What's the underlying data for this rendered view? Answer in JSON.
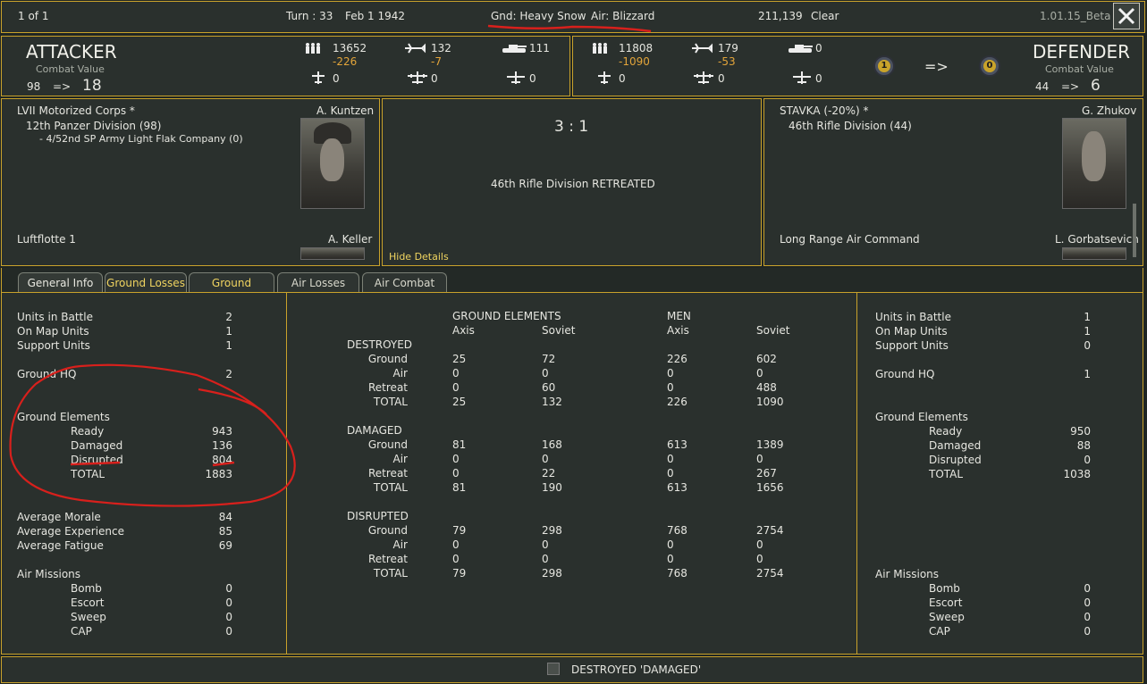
{
  "topbar": {
    "page": "1 of 1",
    "turn": "Turn : 33",
    "date": "Feb 1 1942",
    "ground_weather": "Gnd: Heavy Snow",
    "air_weather": "Air: Blizzard",
    "score": "211,139",
    "weather": "Clear",
    "version": "1.01.15_Beta"
  },
  "attacker": {
    "title": "ATTACKER",
    "combat_value_label": "Combat Value",
    "cv_before": "98",
    "arrow": "=>",
    "cv_after": "18",
    "men": "13652",
    "men_loss": "-226",
    "aircraft": "132",
    "aircraft_loss": "-7",
    "tanks": "111",
    "fighters": "0",
    "bombers": "0",
    "recon": "0"
  },
  "defender": {
    "title": "DEFENDER",
    "combat_value_label": "Combat Value",
    "cv_before": "44",
    "arrow": "=>",
    "cv_after": "6",
    "men": "11808",
    "men_loss": "-1090",
    "aircraft": "179",
    "aircraft_loss": "-53",
    "tanks": "0",
    "fighters": "0",
    "bombers": "0",
    "recon": "0",
    "medal_left": "1",
    "medal_arrow": "=>",
    "medal_right": "0"
  },
  "attacker_units": {
    "corps": "LVII Motorized Corps *",
    "commander": "A. Kuntzen",
    "division": "12th Panzer Division (98)",
    "support": "- 4/52nd SP Army Light Flak Company (0)",
    "air": "Luftflotte 1",
    "air_commander": "A. Keller"
  },
  "result": {
    "odds": "3 : 1",
    "message": "46th Rifle Division RETREATED",
    "hide_details": "Hide Details"
  },
  "defender_units": {
    "corps": "STAVKA (-20%) *",
    "commander": "G. Zhukov",
    "division": "46th Rifle Division (44)",
    "air": "Long Range Air Command",
    "air_commander": "L. Gorbatsevich"
  },
  "tabs": [
    "General Info",
    "Ground Losses",
    "Ground Combat",
    "Air Losses",
    "Air Combat"
  ],
  "left_stats": {
    "units_in_battle": [
      "Units in Battle",
      "2"
    ],
    "on_map_units": [
      "On Map Units",
      "1"
    ],
    "support_units": [
      "Support Units",
      "1"
    ],
    "ground_hq": [
      "Ground HQ",
      "2"
    ],
    "ground_elements": "Ground Elements",
    "ready": [
      "Ready",
      "943"
    ],
    "damaged": [
      "Damaged",
      "136"
    ],
    "disrupted": [
      "Disrupted",
      "804"
    ],
    "total": [
      "TOTAL",
      "1883"
    ],
    "avg_morale": [
      "Average Morale",
      "84"
    ],
    "avg_experience": [
      "Average Experience",
      "85"
    ],
    "avg_fatigue": [
      "Average Fatigue",
      "69"
    ],
    "air_missions": "Air Missions",
    "bomb": [
      "Bomb",
      "0"
    ],
    "escort": [
      "Escort",
      "0"
    ],
    "sweep": [
      "Sweep",
      "0"
    ],
    "cap": [
      "CAP",
      "0"
    ]
  },
  "right_stats": {
    "units_in_battle": [
      "Units in Battle",
      "1"
    ],
    "on_map_units": [
      "On Map Units",
      "1"
    ],
    "support_units": [
      "Support Units",
      "0"
    ],
    "ground_hq": [
      "Ground HQ",
      "1"
    ],
    "ground_elements": "Ground Elements",
    "ready": [
      "Ready",
      "950"
    ],
    "damaged": [
      "Damaged",
      "88"
    ],
    "disrupted": [
      "Disrupted",
      "0"
    ],
    "total": [
      "TOTAL",
      "1038"
    ],
    "air_missions": "Air Missions",
    "bomb": [
      "Bomb",
      "0"
    ],
    "escort": [
      "Escort",
      "0"
    ],
    "sweep": [
      "Sweep",
      "0"
    ],
    "cap": [
      "CAP",
      "0"
    ]
  },
  "center_table": {
    "header_ground": "GROUND ELEMENTS",
    "header_men": "MEN",
    "axis": "Axis",
    "soviet": "Soviet",
    "sections": [
      {
        "title": "DESTROYED",
        "rows": [
          [
            "Ground",
            "25",
            "72",
            "226",
            "602"
          ],
          [
            "Air",
            "0",
            "0",
            "0",
            "0"
          ],
          [
            "Retreat",
            "0",
            "60",
            "0",
            "488"
          ],
          [
            "TOTAL",
            "25",
            "132",
            "226",
            "1090"
          ]
        ]
      },
      {
        "title": "DAMAGED",
        "rows": [
          [
            "Ground",
            "81",
            "168",
            "613",
            "1389"
          ],
          [
            "Air",
            "0",
            "0",
            "0",
            "0"
          ],
          [
            "Retreat",
            "0",
            "22",
            "0",
            "267"
          ],
          [
            "TOTAL",
            "81",
            "190",
            "613",
            "1656"
          ]
        ]
      },
      {
        "title": "DISRUPTED",
        "rows": [
          [
            "Ground",
            "79",
            "298",
            "768",
            "2754"
          ],
          [
            "Air",
            "0",
            "0",
            "0",
            "0"
          ],
          [
            "Retreat",
            "0",
            "0",
            "0",
            "0"
          ],
          [
            "TOTAL",
            "79",
            "298",
            "768",
            "2754"
          ]
        ]
      }
    ]
  },
  "footer": {
    "checkbox_label": "DESTROYED 'DAMAGED'"
  },
  "colors": {
    "border": "#c9a22b",
    "panel": "#2a302d",
    "loss": "#e2a43a",
    "annotation": "#d8201c"
  }
}
